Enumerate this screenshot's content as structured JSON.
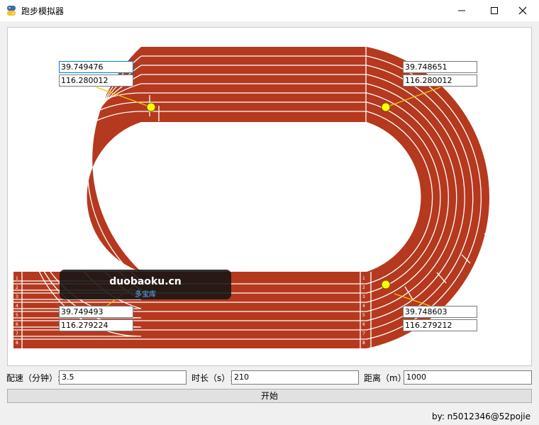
{
  "window": {
    "title": "跑步模拟器",
    "controls": {
      "minimize": "minimize-icon",
      "maximize": "maximize-icon",
      "close": "close-icon"
    }
  },
  "track": {
    "colors": {
      "surface": "#b5391e",
      "lines": "#ffffff",
      "infield": "#ffffff",
      "marker": "#ffff00",
      "connector": "#f5c400"
    },
    "lane_numbers": [
      "1",
      "2",
      "3",
      "4",
      "5",
      "6",
      "7",
      "8"
    ],
    "markers": [
      {
        "id": "top-left",
        "lat": "39.749476",
        "lng": "116.280012"
      },
      {
        "id": "top-right",
        "lat": "39.748651",
        "lng": "116.280012"
      },
      {
        "id": "bottom-left",
        "lat": "39.749493",
        "lng": "116.279224"
      },
      {
        "id": "bottom-right",
        "lat": "39.748603",
        "lng": "116.279212"
      }
    ]
  },
  "watermark": {
    "main": "duobaoku.cn",
    "sub": "多宝库"
  },
  "controls": {
    "pace_label": "配速（分钟）:",
    "pace_value": "3.5",
    "duration_label": "时长（s）:",
    "duration_value": "210",
    "distance_label": "距离（m）:",
    "distance_value": "1000",
    "start_label": "开始"
  },
  "footer": {
    "author": "by: n5012346@52pojie"
  }
}
